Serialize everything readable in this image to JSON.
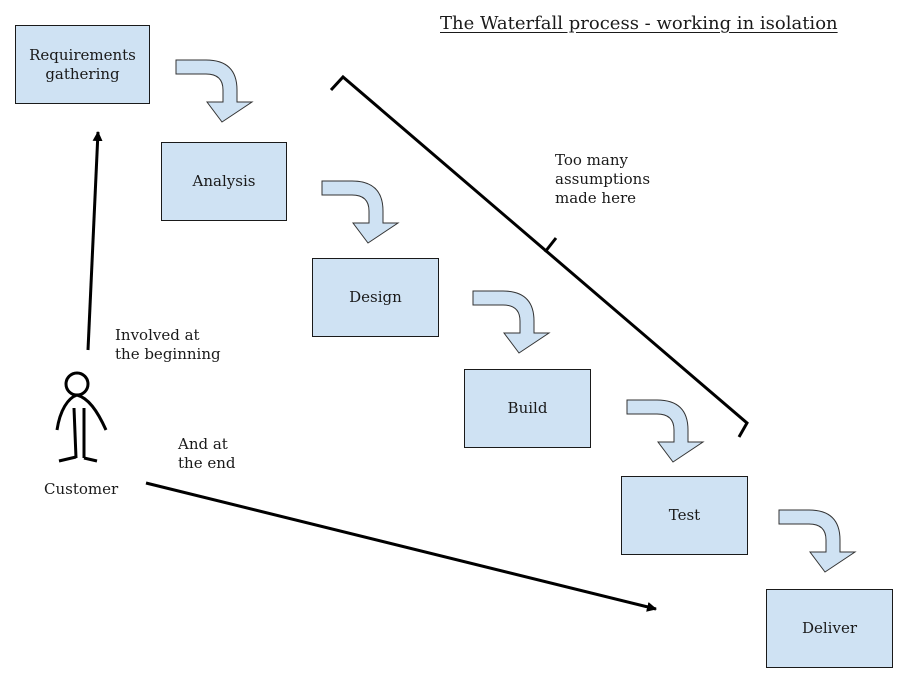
{
  "title": "The Waterfall process - working in isolation",
  "stages": [
    {
      "label": "Requirements\ngathering"
    },
    {
      "label": "Analysis"
    },
    {
      "label": "Design"
    },
    {
      "label": "Build"
    },
    {
      "label": "Test"
    },
    {
      "label": "Deliver"
    }
  ],
  "annotations": {
    "assumptions": "Too many\nassumptions\nmade here",
    "involved_beginning": "Involved at\nthe beginning",
    "and_end": "And at\nthe end",
    "customer": "Customer"
  },
  "colors": {
    "box_fill": "#cfe2f3",
    "stroke": "#000000"
  }
}
